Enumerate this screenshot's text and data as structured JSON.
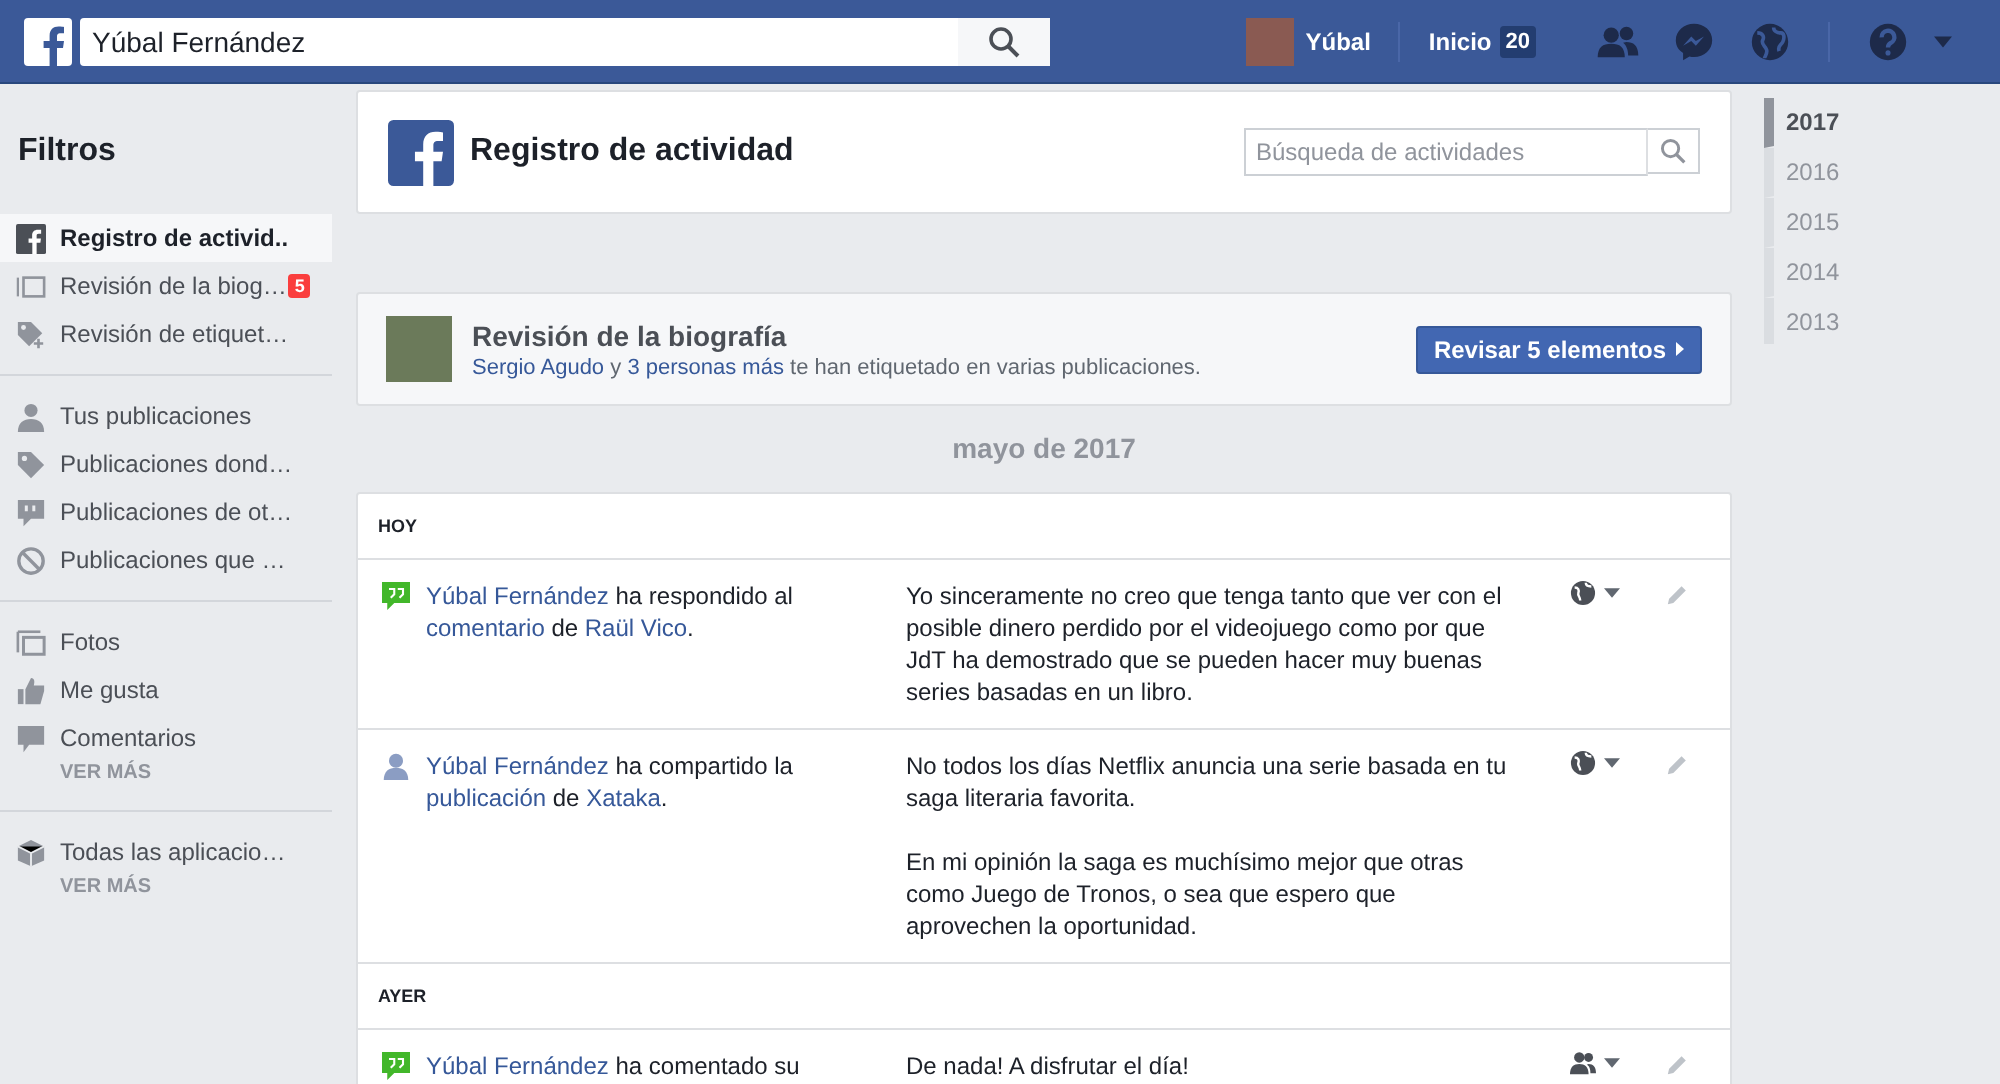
{
  "topbar": {
    "search_value": "Yúbal Fernández",
    "user_name": "Yúbal",
    "home_label": "Inicio",
    "home_count": "20"
  },
  "sidebar": {
    "title": "Filtros",
    "groups": [
      {
        "items": [
          {
            "kind": "fb",
            "label": "Registro de activid..",
            "selected": true
          },
          {
            "kind": "timeline",
            "label": "Revisión de la biog…",
            "selected": false,
            "badge": "5"
          },
          {
            "kind": "tagplus",
            "label": "Revisión de etiquet…",
            "selected": false
          }
        ]
      },
      {
        "items": [
          {
            "kind": "person",
            "label": "Tus publicaciones",
            "selected": false
          },
          {
            "kind": "tag",
            "label": "Publicaciones dond…",
            "selected": false
          },
          {
            "kind": "quote",
            "label": "Publicaciones de ot…",
            "selected": false
          },
          {
            "kind": "ban",
            "label": "Publicaciones que …",
            "selected": false
          }
        ]
      },
      {
        "items": [
          {
            "kind": "photos",
            "label": "Fotos",
            "selected": false
          },
          {
            "kind": "like",
            "label": "Me gusta",
            "selected": false
          },
          {
            "kind": "comment",
            "label": "Comentarios",
            "selected": false
          }
        ],
        "more": "VER MÁS"
      },
      {
        "items": [
          {
            "kind": "cube",
            "label": "Todas las aplicacio…",
            "selected": false
          }
        ],
        "more": "VER MÁS"
      }
    ]
  },
  "header": {
    "title": "Registro de actividad",
    "search_placeholder": "Búsqueda de actividades"
  },
  "review": {
    "title": "Revisión de la biografía",
    "text": [
      {
        "t": "Sergio Agudo",
        "link": true
      },
      {
        "t": " y ",
        "link": false
      },
      {
        "t": "3 personas más",
        "link": true
      },
      {
        "t": " te han etiquetado en varias publicaciones.",
        "link": false
      }
    ],
    "button": "Revisar 5 elementos"
  },
  "month": "mayo de 2017",
  "days": [
    {
      "label": "HOY",
      "entries": [
        {
          "kind": "comment",
          "audience": {
            "kind": "public"
          },
          "actor": [
            {
              "t": "Yúbal Fernández",
              "link": true
            },
            {
              "t": " ha respondido al ",
              "link": false
            },
            {
              "t": "comentario",
              "link": true
            },
            {
              "t": " de ",
              "link": false
            },
            {
              "t": "Raül Vico",
              "link": true
            },
            {
              "t": ".",
              "link": false
            }
          ],
          "content": [
            "Yo sinceramente no creo que tenga tanto que ver con el posible dinero perdido por el videojuego como por que JdT ha demostrado que se pueden hacer muy buenas series basadas en un libro."
          ]
        },
        {
          "kind": "share",
          "audience": {
            "kind": "public"
          },
          "actor": [
            {
              "t": "Yúbal Fernández",
              "link": true
            },
            {
              "t": " ha compartido la ",
              "link": false
            },
            {
              "t": "publicación",
              "link": true
            },
            {
              "t": " de ",
              "link": false
            },
            {
              "t": "Xataka",
              "link": true
            },
            {
              "t": ".",
              "link": false
            }
          ],
          "content": [
            "No todos los días Netflix anuncia una serie basada en tu saga literaria favorita.",
            "En mi opinión la saga es muchísimo mejor que otras como Juego de Tronos, o sea que espero que aprovechen la oportunidad."
          ]
        }
      ]
    },
    {
      "label": "AYER",
      "entries": [
        {
          "kind": "comment",
          "audience": {
            "kind": "friends"
          },
          "actor": [
            {
              "t": "Yúbal Fernández",
              "link": true
            },
            {
              "t": " ha comentado su",
              "link": false
            }
          ],
          "content": [
            "De nada! A disfrutar el día!"
          ]
        }
      ]
    }
  ],
  "years": [
    {
      "label": "2017",
      "selected": true
    },
    {
      "label": "2016",
      "selected": false
    },
    {
      "label": "2015",
      "selected": false
    },
    {
      "label": "2014",
      "selected": false
    },
    {
      "label": "2013",
      "selected": false
    }
  ]
}
